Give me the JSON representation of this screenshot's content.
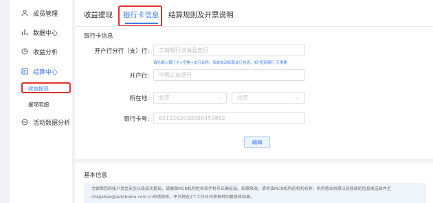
{
  "sidebar": {
    "items": [
      {
        "label": "成员管理",
        "icon": "user-icon"
      },
      {
        "label": "数据中心",
        "icon": "chart-icon"
      },
      {
        "label": "收益分析",
        "icon": "pie-icon"
      },
      {
        "label": "结算中心",
        "icon": "settlement-icon",
        "active": true
      },
      {
        "label": "活动数据分析",
        "icon": "activity-icon"
      }
    ],
    "sub_items": [
      {
        "label": "收益提现",
        "active": true
      },
      {
        "label": "提现明细"
      }
    ]
  },
  "tabs": [
    {
      "label": "收益提现"
    },
    {
      "label": "银行卡信息",
      "active": true
    },
    {
      "label": "结算规则及开票说明"
    }
  ],
  "form": {
    "section_title": "银行卡信息",
    "branch_label": "开户行分行（支）行:",
    "branch_placeholder": "工商银行滨海县支行",
    "hint": "请先输入银行卡+空格+支行名称，系统自动匹配支行信息，如\"招商银行 万寿路",
    "bank_label": "开户行:",
    "bank_value": "中国工商银行",
    "location_label": "所在地:",
    "province": "北京",
    "city": "北京",
    "card_label": "银行卡号:",
    "card_value": "6212262000080459882",
    "edit_button": "编辑"
  },
  "basic_info": {
    "title": "基本信息",
    "line1": "为保障您的账户资金安全以及成功提现，请确保MCN机构姓名和手机号正确无误。如需修改，请将该MCN机构的机构名称、机构营业执照以及修改的信息发送邮件至",
    "line2": "chejiahao@autohome.com.cn申请修改，平台将在2个工作日内审核并回复修改结果。"
  },
  "colors": {
    "accent": "#3a7bf0",
    "highlight": "#e0302a"
  }
}
